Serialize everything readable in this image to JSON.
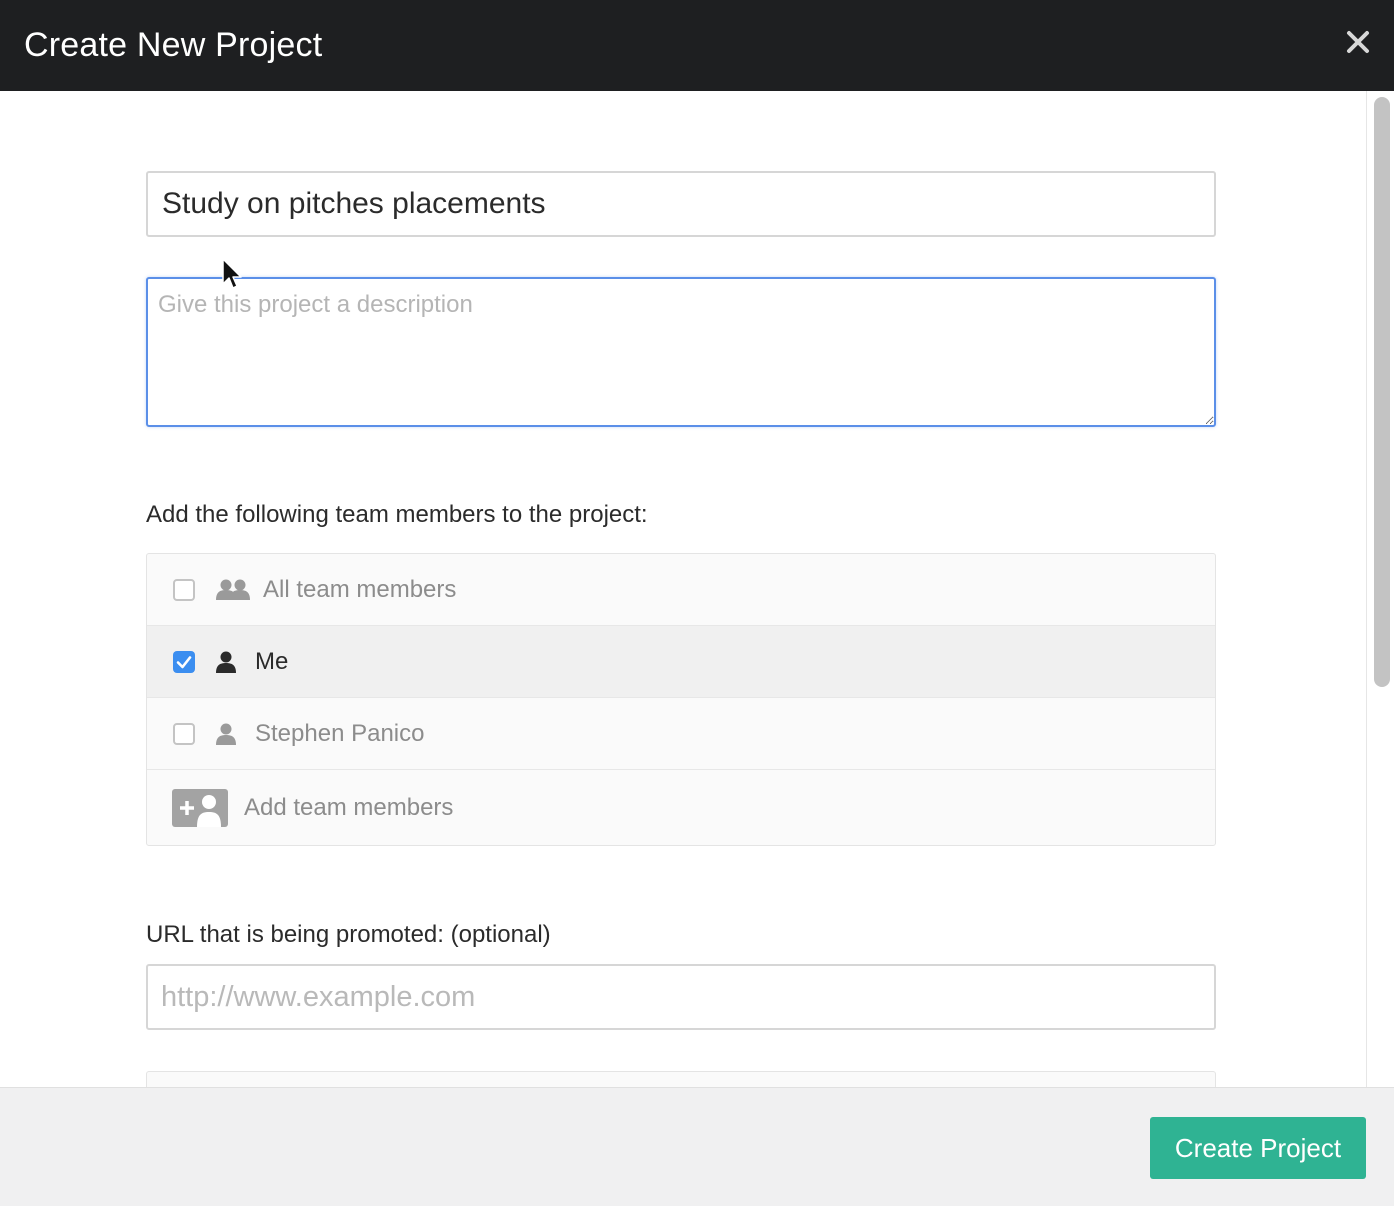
{
  "header": {
    "title": "Create New Project"
  },
  "form": {
    "project_name_value": "Study on pitches placements",
    "description_value": "",
    "description_placeholder": "Give this project a description",
    "team_label": "Add the following team members to the project:",
    "team_members": [
      {
        "label": "All team members",
        "checked": false,
        "icon": "users-group-icon"
      },
      {
        "label": "Me",
        "checked": true,
        "icon": "user-icon"
      },
      {
        "label": "Stephen Panico",
        "checked": false,
        "icon": "user-icon"
      }
    ],
    "add_team_members_label": "Add team members",
    "url_label": "URL that is being promoted: (optional)",
    "url_value": "",
    "url_placeholder": "http://www.example.com"
  },
  "footer": {
    "create_button_label": "Create Project"
  },
  "colors": {
    "header_bg": "#1e1f21",
    "accent_button": "#2fb393",
    "checkbox_checked": "#3b8ef0",
    "focus_border": "#5b8fe8"
  }
}
